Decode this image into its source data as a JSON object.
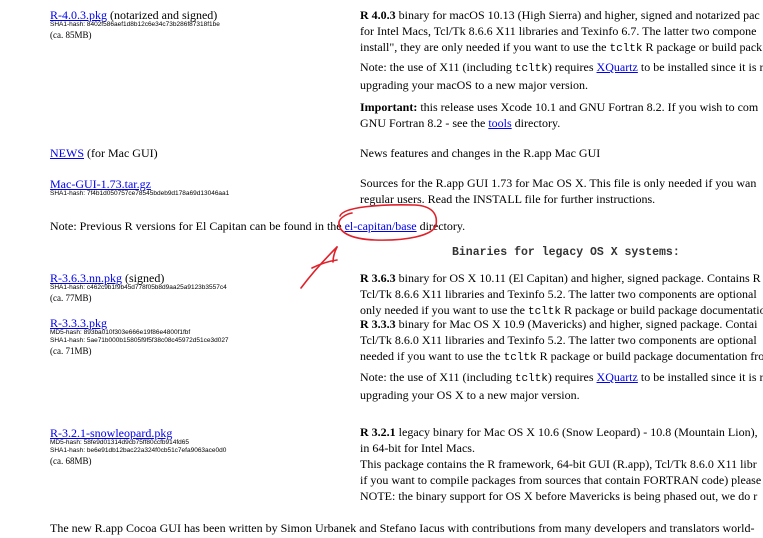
{
  "r403": {
    "link": "R-4.0.3.pkg",
    "suffix": " (notarized and signed)",
    "sha1": "SHA1-hash: 8402f586aef1d8b12c6e34c73b286f87318f1be",
    "size": "(ca. 85MB)",
    "desc_line1_bold": "R 4.0.3",
    "desc_line1_rest": " binary for macOS 10.13 (High Sierra) and higher, signed and notarized pac",
    "desc_line2": "for Intel Macs, Tcl/Tk 8.6.6 X11 libraries and Texinfo 6.7. The latter two compone",
    "desc_line3_pre": "install\", they are only needed if you want to use the ",
    "desc_line3_code": "tcltk",
    "desc_line3_post": " R package or build pack",
    "note_line1_pre": "Note: the use of X11 (including ",
    "note_line1_code": "tcltk",
    "note_line1_mid": ") requires ",
    "note_line1_link": "XQuartz",
    "note_line1_post": " to be installed since it is r",
    "note_line2": "upgrading your macOS to a new major version.",
    "important_bold": "Important:",
    "important_rest": " this release uses Xcode 10.1 and GNU Fortran 8.2. If you wish to com",
    "important_line2_pre": "GNU Fortran 8.2 - see the ",
    "important_line2_link": "tools",
    "important_line2_post": " directory."
  },
  "news": {
    "link": "NEWS",
    "suffix": " (for Mac GUI)",
    "desc": "News features and changes in the R.app Mac GUI"
  },
  "macgui": {
    "link": "Mac-GUI-1.73.tar.gz",
    "sha1": "SHA1-hash: 7f4b1d050757ce78545bdeb9d178a69d13046aa1",
    "desc_line1": "Sources for the R.app GUI 1.73 for Mac OS X. This file is only needed if you wan",
    "desc_line2": "regular users. Read the INSTALL file for further instructions."
  },
  "elcapitan_note": {
    "pre": "Note: Previous R versions for El Capitan can be found in the ",
    "link": "el-capitan/base",
    "post": " directory."
  },
  "legacy_heading": "Binaries for legacy OS X systems:",
  "r363": {
    "link": "R-3.6.3.nn.pkg",
    "suffix": " (signed)",
    "sha1": "SHA1-hash: c462c9b1f9b45d778f05b8d9aa25a9123b3557c4",
    "size": "(ca. 77MB)",
    "desc_bold": "R 3.6.3",
    "desc_line1": " binary for OS X 10.11 (El Capitan) and higher, signed package. Contains R",
    "desc_line2": "Tcl/Tk 8.6.6 X11 libraries and Texinfo 5.2. The latter two components are optional",
    "desc_line3_pre": "only needed if you want to use the ",
    "desc_line3_code": "tcltk",
    "desc_line3_post": " R package or build package documentation"
  },
  "r333": {
    "link": "R-3.3.3.pkg",
    "md5": "MD5-hash: 893ba010f303e666e19f86e4800f1fbf",
    "sha1": "SHA1-hash: 5ae71b000b15805f9f5f38c08c45972d51ce3d027",
    "size": "(ca. 71MB)",
    "desc_bold": "R 3.3.3",
    "desc_line1": " binary for Mac OS X 10.9 (Mavericks) and higher, signed package. Contai",
    "desc_line2": "Tcl/Tk 8.6.0 X11 libraries and Texinfo 5.2. The latter two components are optional",
    "desc_line3_pre": "needed if you want to use the ",
    "desc_line3_code": "tcltk",
    "desc_line3_post": " R package or build package documentation fro",
    "note_line1_pre": "Note: the use of X11 (including ",
    "note_line1_code": "tcltk",
    "note_line1_mid": ") requires ",
    "note_line1_link": "XQuartz",
    "note_line1_post": " to be installed since it is r",
    "note_line2": "upgrading your OS X to a new major version."
  },
  "r321": {
    "link": "R-3.2.1-snowleopard.pkg",
    "md5": "MD5-hash: 58fe9d01314d9cb75ff80ccfb914fd65",
    "sha1": "SHA1-hash: be6e91db12bac22a324f0cb51c7efa9063ace0d0",
    "size": "(ca. 68MB)",
    "desc_bold": "R 3.2.1",
    "desc_line1": " legacy binary for Mac OS X 10.6 (Snow Leopard) - 10.8 (Mountain Lion),",
    "desc_line2": "in 64-bit for Intel Macs.",
    "desc_line3": "This package contains the R framework, 64-bit GUI (R.app), Tcl/Tk 8.6.0 X11 libr",
    "desc_line4": "if you want to compile packages from sources that contain FORTRAN code) please",
    "desc_line5_pre": "NOTE: the binary support for OS X before Mavericks is being phased out, we do r"
  },
  "footer": "The new R.app Cocoa GUI has been written by Simon Urbanek and Stefano Iacus with contributions from many developers and translators world-",
  "colors": {
    "link": "#0000ee",
    "annotation": "#e0202a"
  }
}
